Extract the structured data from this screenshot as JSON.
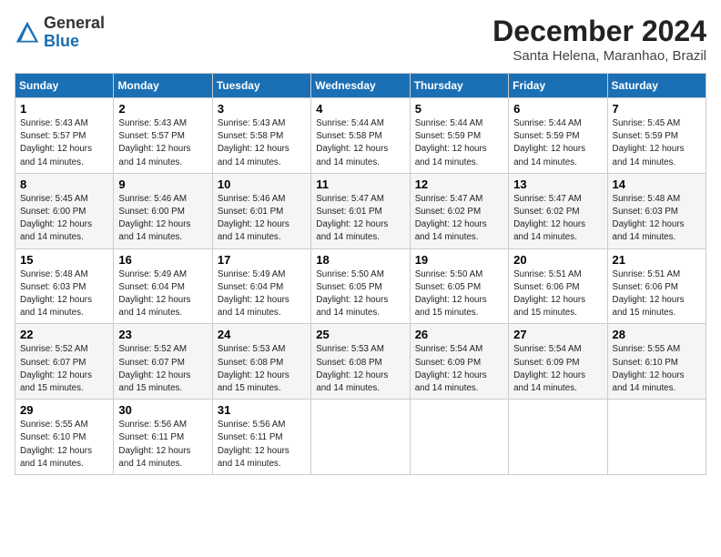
{
  "header": {
    "logo_line1": "General",
    "logo_line2": "Blue",
    "month_title": "December 2024",
    "location": "Santa Helena, Maranhao, Brazil"
  },
  "weekdays": [
    "Sunday",
    "Monday",
    "Tuesday",
    "Wednesday",
    "Thursday",
    "Friday",
    "Saturday"
  ],
  "weeks": [
    [
      {
        "day": "1",
        "sunrise": "5:43 AM",
        "sunset": "5:57 PM",
        "daylight": "12 hours and 14 minutes."
      },
      {
        "day": "2",
        "sunrise": "5:43 AM",
        "sunset": "5:57 PM",
        "daylight": "12 hours and 14 minutes."
      },
      {
        "day": "3",
        "sunrise": "5:43 AM",
        "sunset": "5:58 PM",
        "daylight": "12 hours and 14 minutes."
      },
      {
        "day": "4",
        "sunrise": "5:44 AM",
        "sunset": "5:58 PM",
        "daylight": "12 hours and 14 minutes."
      },
      {
        "day": "5",
        "sunrise": "5:44 AM",
        "sunset": "5:59 PM",
        "daylight": "12 hours and 14 minutes."
      },
      {
        "day": "6",
        "sunrise": "5:44 AM",
        "sunset": "5:59 PM",
        "daylight": "12 hours and 14 minutes."
      },
      {
        "day": "7",
        "sunrise": "5:45 AM",
        "sunset": "5:59 PM",
        "daylight": "12 hours and 14 minutes."
      }
    ],
    [
      {
        "day": "8",
        "sunrise": "5:45 AM",
        "sunset": "6:00 PM",
        "daylight": "12 hours and 14 minutes."
      },
      {
        "day": "9",
        "sunrise": "5:46 AM",
        "sunset": "6:00 PM",
        "daylight": "12 hours and 14 minutes."
      },
      {
        "day": "10",
        "sunrise": "5:46 AM",
        "sunset": "6:01 PM",
        "daylight": "12 hours and 14 minutes."
      },
      {
        "day": "11",
        "sunrise": "5:47 AM",
        "sunset": "6:01 PM",
        "daylight": "12 hours and 14 minutes."
      },
      {
        "day": "12",
        "sunrise": "5:47 AM",
        "sunset": "6:02 PM",
        "daylight": "12 hours and 14 minutes."
      },
      {
        "day": "13",
        "sunrise": "5:47 AM",
        "sunset": "6:02 PM",
        "daylight": "12 hours and 14 minutes."
      },
      {
        "day": "14",
        "sunrise": "5:48 AM",
        "sunset": "6:03 PM",
        "daylight": "12 hours and 14 minutes."
      }
    ],
    [
      {
        "day": "15",
        "sunrise": "5:48 AM",
        "sunset": "6:03 PM",
        "daylight": "12 hours and 14 minutes."
      },
      {
        "day": "16",
        "sunrise": "5:49 AM",
        "sunset": "6:04 PM",
        "daylight": "12 hours and 14 minutes."
      },
      {
        "day": "17",
        "sunrise": "5:49 AM",
        "sunset": "6:04 PM",
        "daylight": "12 hours and 14 minutes."
      },
      {
        "day": "18",
        "sunrise": "5:50 AM",
        "sunset": "6:05 PM",
        "daylight": "12 hours and 14 minutes."
      },
      {
        "day": "19",
        "sunrise": "5:50 AM",
        "sunset": "6:05 PM",
        "daylight": "12 hours and 15 minutes."
      },
      {
        "day": "20",
        "sunrise": "5:51 AM",
        "sunset": "6:06 PM",
        "daylight": "12 hours and 15 minutes."
      },
      {
        "day": "21",
        "sunrise": "5:51 AM",
        "sunset": "6:06 PM",
        "daylight": "12 hours and 15 minutes."
      }
    ],
    [
      {
        "day": "22",
        "sunrise": "5:52 AM",
        "sunset": "6:07 PM",
        "daylight": "12 hours and 15 minutes."
      },
      {
        "day": "23",
        "sunrise": "5:52 AM",
        "sunset": "6:07 PM",
        "daylight": "12 hours and 15 minutes."
      },
      {
        "day": "24",
        "sunrise": "5:53 AM",
        "sunset": "6:08 PM",
        "daylight": "12 hours and 15 minutes."
      },
      {
        "day": "25",
        "sunrise": "5:53 AM",
        "sunset": "6:08 PM",
        "daylight": "12 hours and 14 minutes."
      },
      {
        "day": "26",
        "sunrise": "5:54 AM",
        "sunset": "6:09 PM",
        "daylight": "12 hours and 14 minutes."
      },
      {
        "day": "27",
        "sunrise": "5:54 AM",
        "sunset": "6:09 PM",
        "daylight": "12 hours and 14 minutes."
      },
      {
        "day": "28",
        "sunrise": "5:55 AM",
        "sunset": "6:10 PM",
        "daylight": "12 hours and 14 minutes."
      }
    ],
    [
      {
        "day": "29",
        "sunrise": "5:55 AM",
        "sunset": "6:10 PM",
        "daylight": "12 hours and 14 minutes."
      },
      {
        "day": "30",
        "sunrise": "5:56 AM",
        "sunset": "6:11 PM",
        "daylight": "12 hours and 14 minutes."
      },
      {
        "day": "31",
        "sunrise": "5:56 AM",
        "sunset": "6:11 PM",
        "daylight": "12 hours and 14 minutes."
      },
      null,
      null,
      null,
      null
    ]
  ]
}
